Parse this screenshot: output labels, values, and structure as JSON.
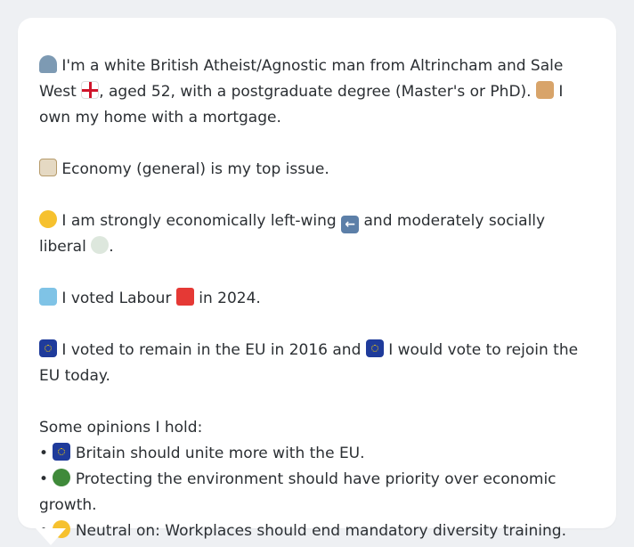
{
  "profile": {
    "p1_a": "I'm a white British Atheist/Agnostic man from Altrincham and Sale West",
    "p1_b": ", aged 52, with a postgraduate degree (Master's or PhD).",
    "p1_c": "I own my home with a mortgage.",
    "p2": "Economy (general) is my top issue.",
    "p3_a": "I am strongly economically left-wing",
    "p3_b": "and moderately socially liberal",
    "p3_c": ".",
    "p4_a": "I voted Labour",
    "p4_b": "in 2024.",
    "p5_a": "I voted to remain in the EU in 2016 and",
    "p5_b": "I would vote to rejoin the EU today.",
    "opinions_heading": "Some opinions I hold:",
    "opinions": [
      {
        "bullet": "•",
        "text": "Britain should unite more with the EU."
      },
      {
        "bullet": "•",
        "text": "Protecting the environment should have priority over economic growth."
      },
      {
        "bullet": "•",
        "text": "Neutral on: Workplaces should end mandatory diversity training."
      }
    ]
  },
  "icons": {
    "person": "person-icon",
    "england_flag": "england-flag-icon",
    "house": "house-icon",
    "money": "money-icon",
    "thinking": "thinking-face-icon",
    "left_arrow": "left-arrow-icon",
    "dove": "dove-icon",
    "ballot": "ballot-box-icon",
    "red_square": "red-square-icon",
    "eu_flag": "eu-flag-icon",
    "tree": "tree-icon",
    "neutral": "neutral-face-icon"
  },
  "colors": {
    "background": "#eef0f3",
    "card": "#ffffff",
    "text": "#2b2f33",
    "labour_red": "#e53935"
  }
}
